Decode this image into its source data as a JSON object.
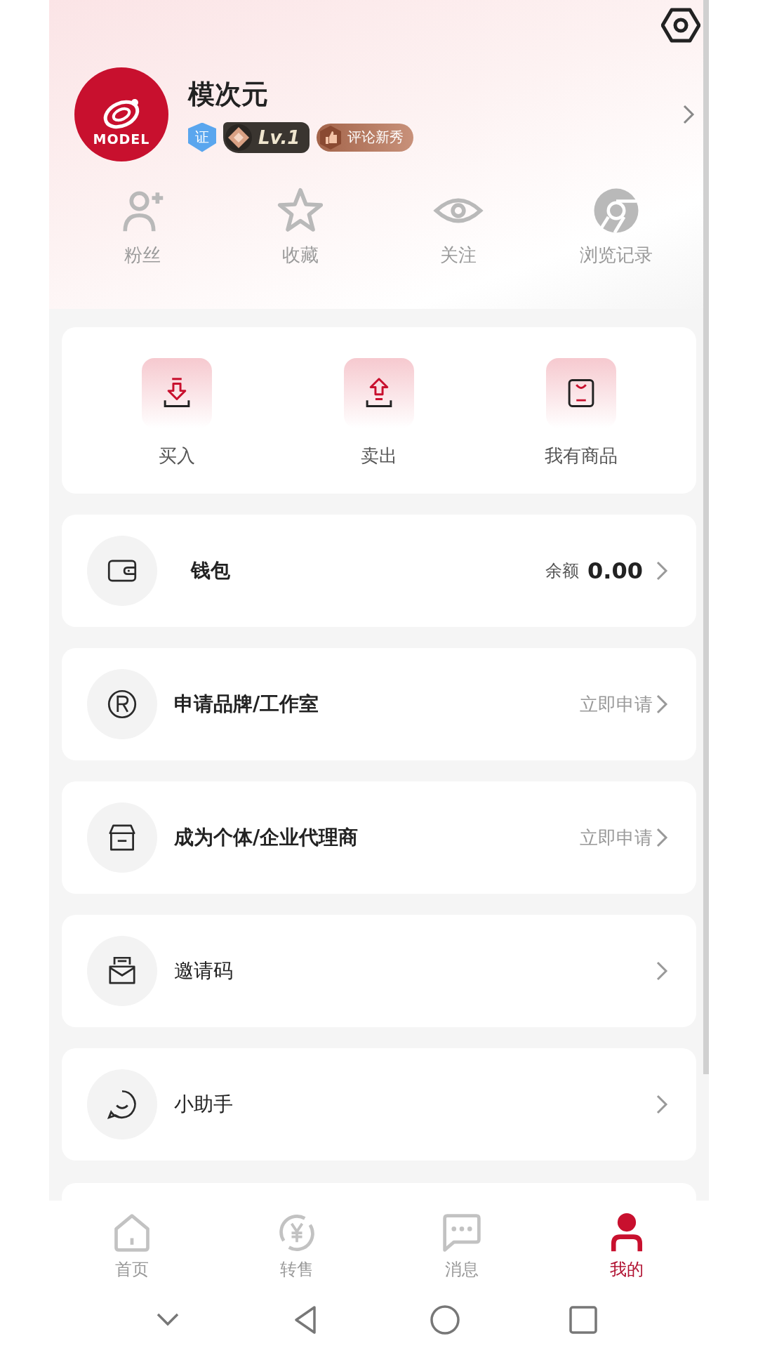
{
  "profile": {
    "name": "模次元",
    "avatar_text": "MODEL",
    "verified_badge": "证",
    "level_badge": "Lv.1",
    "title_badge": "评论新秀"
  },
  "stats": [
    {
      "label": "粉丝"
    },
    {
      "label": "收藏"
    },
    {
      "label": "关注"
    },
    {
      "label": "浏览记录"
    }
  ],
  "trade_actions": [
    {
      "label": "买入"
    },
    {
      "label": "卖出"
    },
    {
      "label": "我有商品"
    }
  ],
  "rows": [
    {
      "kind": "wallet",
      "label": "钱包",
      "balance_label": "余额",
      "balance": "0.00"
    },
    {
      "kind": "apply",
      "label": "申请品牌/工作室",
      "action": "立即申请"
    },
    {
      "kind": "apply",
      "label": "成为个体/企业代理商",
      "action": "立即申请"
    },
    {
      "kind": "plain",
      "label": "邀请码"
    },
    {
      "kind": "plain",
      "label": "小助手"
    }
  ],
  "tab_bar": [
    {
      "label": "首页",
      "selected": false
    },
    {
      "label": "转售",
      "selected": false
    },
    {
      "label": "消息",
      "selected": false
    },
    {
      "label": "我的",
      "selected": true
    }
  ]
}
